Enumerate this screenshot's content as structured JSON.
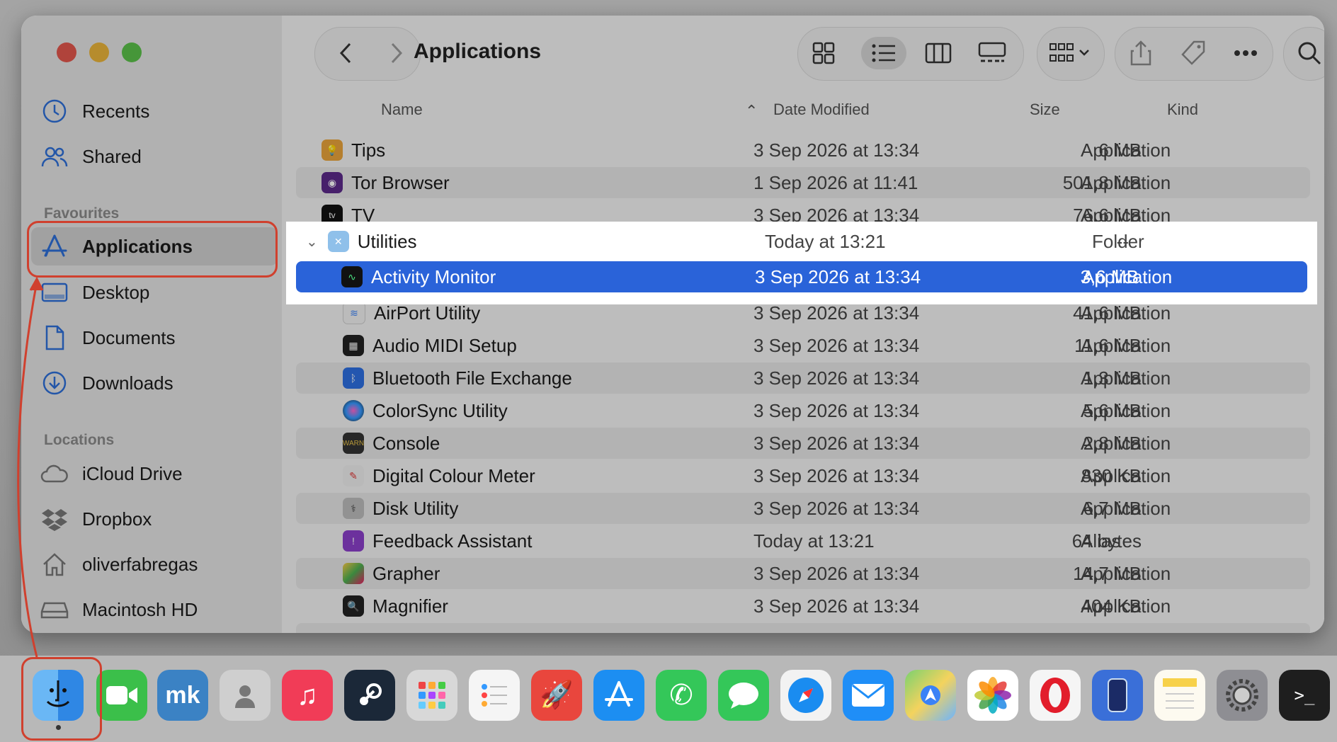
{
  "window": {
    "title": "Applications"
  },
  "sidebar": {
    "recents": "Recents",
    "shared": "Shared",
    "favourites_header": "Favourites",
    "applications": "Applications",
    "desktop": "Desktop",
    "documents": "Documents",
    "downloads": "Downloads",
    "locations_header": "Locations",
    "icloud": "iCloud Drive",
    "dropbox": "Dropbox",
    "home": "oliverfabregas",
    "hd": "Macintosh HD"
  },
  "columns": {
    "name": "Name",
    "date": "Date Modified",
    "size": "Size",
    "kind": "Kind"
  },
  "rows": [
    {
      "name": "Tips",
      "date": "3 Sep 2026 at 13:34",
      "size": "6 MB",
      "kind": "Application"
    },
    {
      "name": "Tor Browser",
      "date": "1 Sep 2026 at 11:41",
      "size": "501,8 MB",
      "kind": "Application"
    },
    {
      "name": "TV",
      "date": "3 Sep 2026 at 13:34",
      "size": "76,6 MB",
      "kind": "Application"
    },
    {
      "name": "Utilities",
      "date": "Today at 13:21",
      "size": "--",
      "kind": "Folder"
    },
    {
      "name": "Activity Monitor",
      "date": "3 Sep 2026 at 13:34",
      "size": "3,6 MB",
      "kind": "Application"
    },
    {
      "name": "AirPort Utility",
      "date": "3 Sep 2026 at 13:34",
      "size": "41,6 MB",
      "kind": "Application"
    },
    {
      "name": "Audio MIDI Setup",
      "date": "3 Sep 2026 at 13:34",
      "size": "11,6 MB",
      "kind": "Application"
    },
    {
      "name": "Bluetooth File Exchange",
      "date": "3 Sep 2026 at 13:34",
      "size": "1,3 MB",
      "kind": "Application"
    },
    {
      "name": "ColorSync Utility",
      "date": "3 Sep 2026 at 13:34",
      "size": "5,6 MB",
      "kind": "Application"
    },
    {
      "name": "Console",
      "date": "3 Sep 2026 at 13:34",
      "size": "2,8 MB",
      "kind": "Application"
    },
    {
      "name": "Digital Colour Meter",
      "date": "3 Sep 2026 at 13:34",
      "size": "830 KB",
      "kind": "Application"
    },
    {
      "name": "Disk Utility",
      "date": "3 Sep 2026 at 13:34",
      "size": "6,7 MB",
      "kind": "Application"
    },
    {
      "name": "Feedback Assistant",
      "date": "Today at 13:21",
      "size": "64 bytes",
      "kind": "Alias"
    },
    {
      "name": "Grapher",
      "date": "3 Sep 2026 at 13:34",
      "size": "14,7 MB",
      "kind": "Application"
    },
    {
      "name": "Magnifier",
      "date": "3 Sep 2026 at 13:34",
      "size": "404 KB",
      "kind": "Application"
    }
  ],
  "colors": {
    "selection": "#2a63d9",
    "annotation": "#d0402e"
  }
}
